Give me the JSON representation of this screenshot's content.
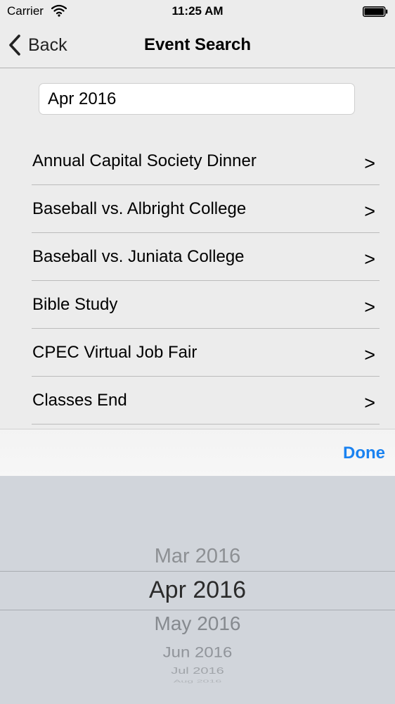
{
  "status_bar": {
    "carrier": "Carrier",
    "time": "11:25 AM",
    "wifi_icon": "wifi-icon",
    "battery_icon": "battery-icon"
  },
  "nav": {
    "back_label": "Back",
    "back_icon": "chevron-left-icon",
    "title": "Event Search"
  },
  "search": {
    "value": "Apr 2016"
  },
  "events": [
    {
      "label": "Annual Capital Society Dinner",
      "chevron": ">"
    },
    {
      "label": "Baseball vs. Albright College",
      "chevron": ">"
    },
    {
      "label": "Baseball vs. Juniata College",
      "chevron": ">"
    },
    {
      "label": "Bible Study",
      "chevron": ">"
    },
    {
      "label": "CPEC Virtual Job Fair",
      "chevron": ">"
    },
    {
      "label": "Classes End",
      "chevron": ">"
    }
  ],
  "toolbar": {
    "done_label": "Done"
  },
  "picker": {
    "items": [
      "Mar 2016",
      "Apr 2016",
      "May 2016",
      "Jun 2016",
      "Jul 2016",
      "Aug 2016"
    ],
    "selected": "Apr 2016"
  },
  "colors": {
    "accent": "#1a82f0",
    "background": "#ececec",
    "picker_background": "#d1d5db"
  }
}
